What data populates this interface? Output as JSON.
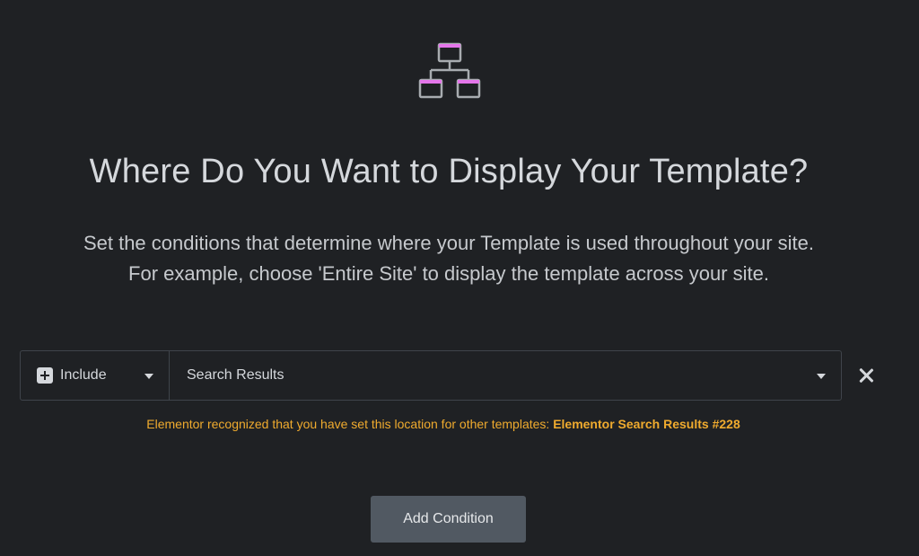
{
  "header": {
    "icon": "sitemap-icon",
    "title": "Where Do You Want to Display Your Template?",
    "description_line1": "Set the conditions that determine where your Template is used throughout your site.",
    "description_line2": "For example, choose 'Entire Site' to display the template across your site."
  },
  "condition": {
    "type_icon": "plus-square-icon",
    "type_value": "Include",
    "location_value": "Search Results",
    "remove_icon": "close-icon"
  },
  "notice": {
    "text": "Elementor recognized that you have set this location for other templates: ",
    "link": "Elementor Search Results #228"
  },
  "actions": {
    "add_condition_label": "Add Condition"
  },
  "colors": {
    "background": "#1f2124",
    "accent_pink": "#e476ea",
    "warning": "#f0ab2e",
    "button": "#515962"
  }
}
